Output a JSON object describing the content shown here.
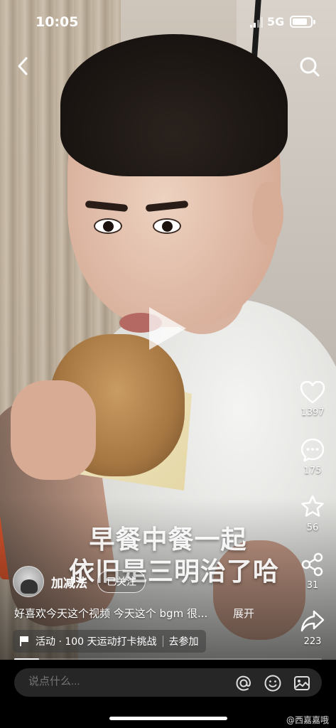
{
  "status_bar": {
    "time": "10:05",
    "network": "5G"
  },
  "video": {
    "caption_line1": "早餐中餐一起",
    "caption_line2": "依旧是三明治了哈",
    "progress": 0.08
  },
  "actions": {
    "like_count": "1397",
    "comment_count": "175",
    "favorite_count": "56",
    "share_count": "31",
    "forward_count": "223"
  },
  "author": {
    "name": "加减法",
    "follow_label": "已关注"
  },
  "description": {
    "text": "好喜欢今天这个视频 今天这个 bgm 很...",
    "more_label": "展开"
  },
  "activity": {
    "label": "活动 · 100 天运动打卡挑战",
    "join_label": "去参加"
  },
  "comment_bar": {
    "placeholder": "说点什么..."
  },
  "watermark": "@西嘉嘉哦",
  "icons": [
    "back-icon",
    "search-icon",
    "heart-icon",
    "comment-icon",
    "star-icon",
    "share-icon",
    "forward-icon",
    "at-icon",
    "emoji-icon",
    "image-icon",
    "flag-icon"
  ]
}
